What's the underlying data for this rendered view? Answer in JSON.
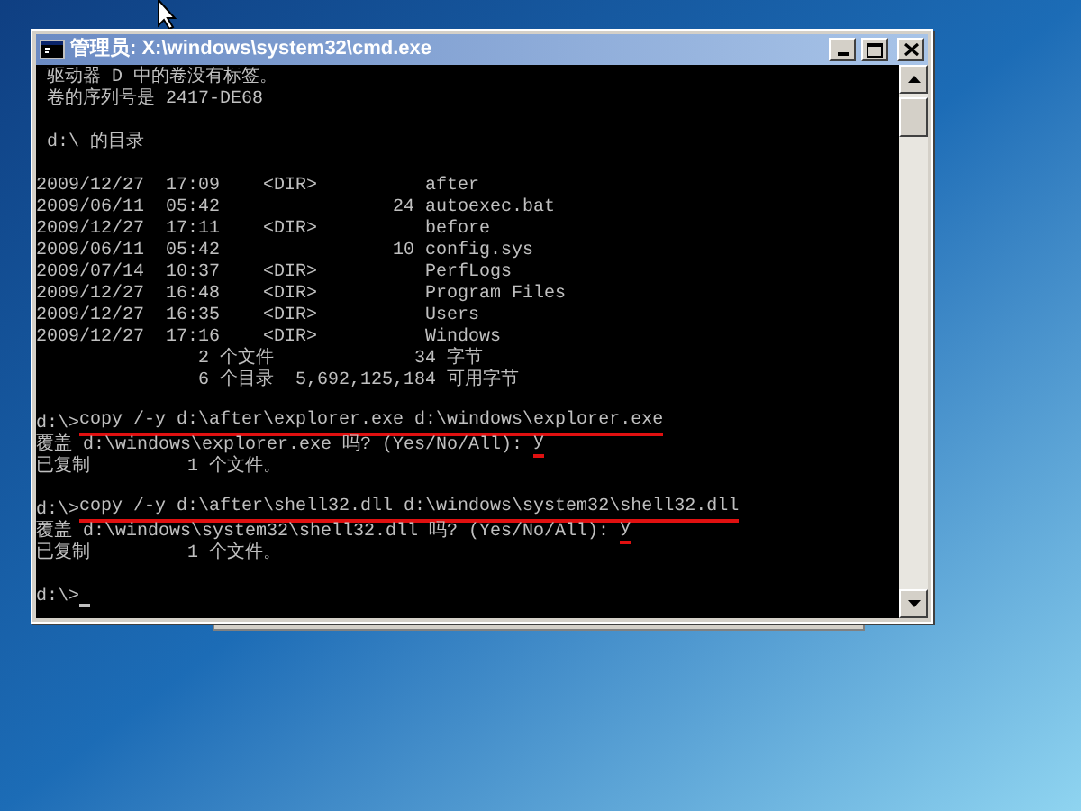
{
  "window": {
    "title": "管理员: X:\\windows\\system32\\cmd.exe"
  },
  "console": {
    "lines": [
      {
        "kind": "text",
        "segments": [
          {
            "text": " 驱动器 D 中的卷没有标签。",
            "marked": false
          }
        ]
      },
      {
        "kind": "text",
        "segments": [
          {
            "text": " 卷的序列号是 2417-DE68",
            "marked": false
          }
        ]
      },
      {
        "kind": "blank"
      },
      {
        "kind": "text",
        "segments": [
          {
            "text": " d:\\ 的目录",
            "marked": false
          }
        ]
      },
      {
        "kind": "blank"
      },
      {
        "kind": "text",
        "segments": [
          {
            "text": "2009/12/27  17:09    <DIR>          after",
            "marked": false
          }
        ]
      },
      {
        "kind": "text",
        "segments": [
          {
            "text": "2009/06/11  05:42                24 autoexec.bat",
            "marked": false
          }
        ]
      },
      {
        "kind": "text",
        "segments": [
          {
            "text": "2009/12/27  17:11    <DIR>          before",
            "marked": false
          }
        ]
      },
      {
        "kind": "text",
        "segments": [
          {
            "text": "2009/06/11  05:42                10 config.sys",
            "marked": false
          }
        ]
      },
      {
        "kind": "text",
        "segments": [
          {
            "text": "2009/07/14  10:37    <DIR>          PerfLogs",
            "marked": false
          }
        ]
      },
      {
        "kind": "text",
        "segments": [
          {
            "text": "2009/12/27  16:48    <DIR>          Program Files",
            "marked": false
          }
        ]
      },
      {
        "kind": "text",
        "segments": [
          {
            "text": "2009/12/27  16:35    <DIR>          Users",
            "marked": false
          }
        ]
      },
      {
        "kind": "text",
        "segments": [
          {
            "text": "2009/12/27  17:16    <DIR>          Windows",
            "marked": false
          }
        ]
      },
      {
        "kind": "text",
        "segments": [
          {
            "text": "               2 个文件             34 字节",
            "marked": false
          }
        ]
      },
      {
        "kind": "text",
        "segments": [
          {
            "text": "               6 个目录  5,692,125,184 可用字节",
            "marked": false
          }
        ]
      },
      {
        "kind": "blank"
      },
      {
        "kind": "text",
        "segments": [
          {
            "text": "d:\\>",
            "marked": false
          },
          {
            "text": "copy /-y d:\\after\\explorer.exe d:\\windows\\explorer.exe",
            "marked": true
          }
        ]
      },
      {
        "kind": "text",
        "segments": [
          {
            "text": "覆盖 d:\\windows\\explorer.exe 吗? (Yes/No/All): ",
            "marked": false
          },
          {
            "text": "y",
            "marked": true
          }
        ]
      },
      {
        "kind": "text",
        "segments": [
          {
            "text": "已复制         1 个文件。",
            "marked": false
          }
        ]
      },
      {
        "kind": "blank"
      },
      {
        "kind": "text",
        "segments": [
          {
            "text": "d:\\>",
            "marked": false
          },
          {
            "text": "copy /-y d:\\after\\shell32.dll d:\\windows\\system32\\shell32.dll",
            "marked": true
          }
        ]
      },
      {
        "kind": "text",
        "segments": [
          {
            "text": "覆盖 d:\\windows\\system32\\shell32.dll 吗? (Yes/No/All): ",
            "marked": false
          },
          {
            "text": "y",
            "marked": true
          }
        ]
      },
      {
        "kind": "text",
        "segments": [
          {
            "text": "已复制         1 个文件。",
            "marked": false
          }
        ]
      },
      {
        "kind": "blank"
      },
      {
        "kind": "prompt",
        "segments": [
          {
            "text": "d:\\>",
            "marked": false
          }
        ]
      }
    ]
  }
}
